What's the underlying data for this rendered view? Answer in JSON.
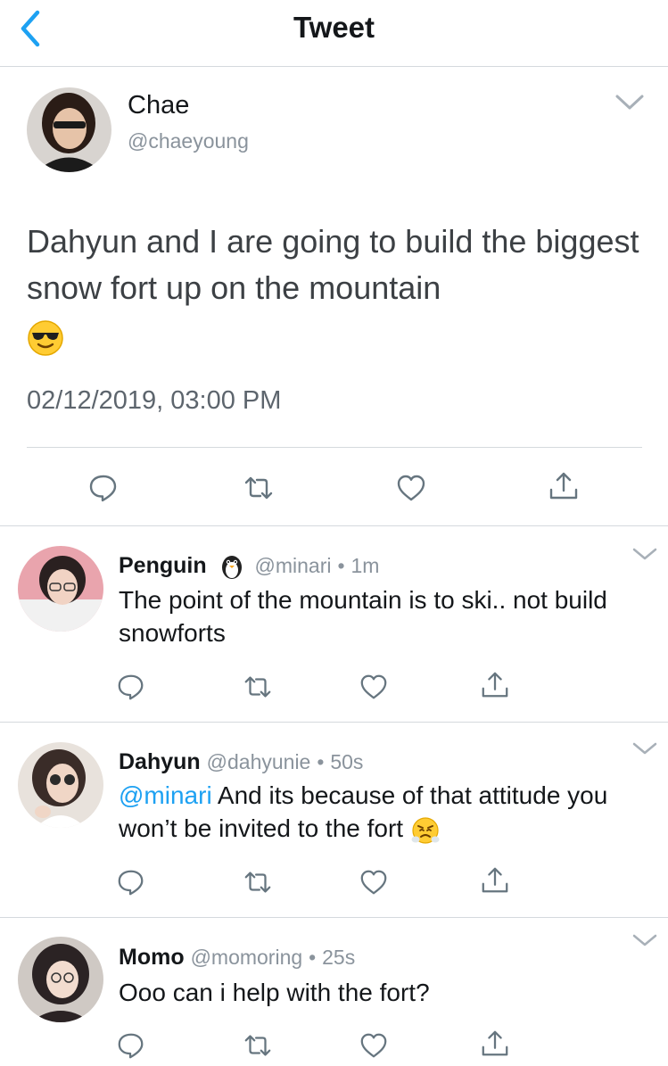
{
  "header": {
    "title": "Tweet"
  },
  "main_tweet": {
    "name": "Chae",
    "handle": "@chaeyoung",
    "text": "Dahyun and I are going to build the biggest snow fort up on the mountain",
    "emoji": "smiling-face-with-sunglasses",
    "timestamp": "02/12/2019, 03:00 PM"
  },
  "replies": [
    {
      "name": "Penguin",
      "name_emoji": "penguin",
      "handle": "@minari",
      "time": "1m",
      "text": "The point of the mountain is to ski.. not build snowforts",
      "avatar_color": "#e9a4ad"
    },
    {
      "name": "Dahyun",
      "handle": "@dahyunie",
      "time": "50s",
      "mention": "@minari",
      "text": " And its because of that attitude you won’t be invited to the fort",
      "text_emoji": "face-with-steam-from-nose",
      "avatar_color": "#3a2c28"
    },
    {
      "name": "Momo",
      "handle": "@momoring",
      "time": "25s",
      "text": "Ooo can i help with the fort?",
      "avatar_color": "#2b2324"
    }
  ],
  "dot": "•",
  "colors": {
    "accent": "#1da1f2",
    "text": "#14171a",
    "muted": "#8a939c",
    "divider": "#d5d9dd"
  },
  "icons": [
    "chevron-left-icon",
    "chevron-down-icon",
    "reply-icon",
    "retweet-icon",
    "like-icon",
    "share-icon"
  ]
}
